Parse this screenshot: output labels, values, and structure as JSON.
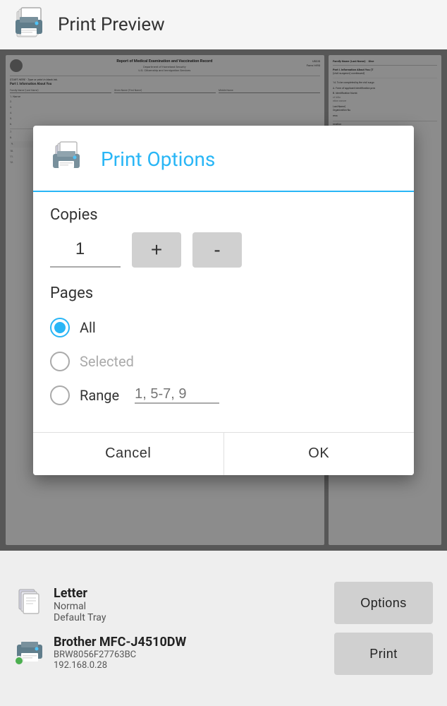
{
  "header": {
    "title": "Print Preview",
    "icon_label": "print-preview-app-icon"
  },
  "modal": {
    "title": "Print Options",
    "icon_label": "print-options-icon",
    "copies_label": "Copies",
    "copies_value": "1",
    "plus_label": "+",
    "minus_label": "-",
    "pages_label": "Pages",
    "radio_all_label": "All",
    "radio_selected_label": "Selected",
    "radio_range_label": "Range",
    "range_placeholder": "1, 5-7, 9",
    "cancel_label": "Cancel",
    "ok_label": "OK",
    "selected_page": "all"
  },
  "bottom": {
    "paper_name": "Letter",
    "paper_normal": "Normal",
    "paper_tray": "Default Tray",
    "printer_name": "Brother MFC-J4510DW",
    "printer_id": "BRW8056F27763BC",
    "printer_ip": "192.168.0.28",
    "options_label": "Options",
    "print_label": "Print"
  },
  "document": {
    "title": "Report of Medical Examination and Vaccination Record",
    "dept": "Department of Homeland Security",
    "agency": "U.S. Citizenship and Immigration Services",
    "form_id": "USCIS\nForm I-693",
    "instruction": "START HERE - Type or print in black ink.",
    "section": "Part I. Information About You",
    "field1": "Family Name (Last Name)",
    "field2": "Given Name (First Name)",
    "field3": "Middle Name"
  },
  "colors": {
    "accent": "#29b6f6",
    "green": "#4caf50",
    "button_bg": "#d0d0d0",
    "header_bg": "#f5f5f5"
  }
}
